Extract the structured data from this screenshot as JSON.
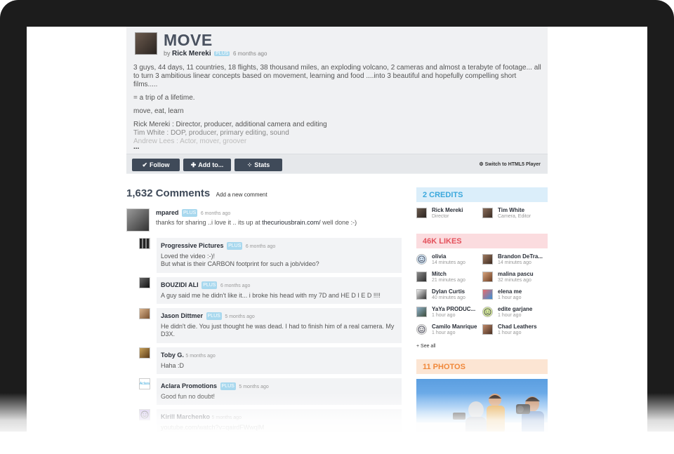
{
  "video": {
    "title": "MOVE",
    "by_prefix": "by",
    "uploader": "Rick Mereki",
    "uploader_badge": "PLUS",
    "uploaded": "6 months ago",
    "description": {
      "p1": "3 guys, 44 days, 11 countries, 18 flights, 38 thousand miles, an exploding volcano, 2 cameras and almost a terabyte of footage... all to turn 3 ambitious linear concepts based on movement, learning and food ....into 3 beautiful and hopefully compelling short films.....",
      "p2": "= a trip of a lifetime.",
      "p3": "move, eat, learn",
      "credit1": "Rick Mereki : Director, producer, additional camera and editing",
      "credit2": "Tim White : DOP, producer, primary editing, sound",
      "credit3": "Andrew Lees : Actor, mover, groover",
      "more": "..."
    }
  },
  "actions": {
    "follow": "Follow",
    "add_to": "Add to...",
    "stats": "Stats",
    "html5": "Switch to HTML5 Player"
  },
  "comments": {
    "count": "1,632 Comments",
    "add": "Add a new comment",
    "top": {
      "author": "mpared",
      "badge": "PLUS",
      "time": "6 months ago",
      "text_before": "thanks for sharing ..i love it .. its up at",
      "link": "thecuriousbrain.com/",
      "text_after": "well done :-)"
    },
    "replies": [
      {
        "author": "Progressive Pictures",
        "badge": "PLUS",
        "time": "6 months ago",
        "line1": "Loved the video :-)!",
        "line2": "But what is their CARBON footprint for such a job/video?"
      },
      {
        "author": "BOUZIDI ALI",
        "badge": "PLUS",
        "time": "6 months ago",
        "line1": "A guy said me he didn't like it... i broke his head with my 7D and HE D I E D !!!!"
      },
      {
        "author": "Jason Dittmer",
        "badge": "PLUS",
        "time": "5 months ago",
        "line1": "He didn't die. You just thought he was dead. I had to finish him of a real camera. My D3X."
      },
      {
        "author": "Toby G.",
        "time": "5 months ago",
        "line1": "Haha :D"
      },
      {
        "author": "Aclara Promotions",
        "badge": "PLUS",
        "time": "5 months ago",
        "line1": "Good fun no doubt!",
        "avatar_text": "Aclara"
      },
      {
        "author": "Kirill Marchenko",
        "time": "5 months ago",
        "line1": "youtube.com/watch?v=qairdFWwqlM"
      }
    ]
  },
  "sidebar": {
    "credits_title": "2 CREDITS",
    "credits": [
      {
        "name": "Rick Mereki",
        "role": "Director"
      },
      {
        "name": "Tim White",
        "role": "Camera, Editor"
      }
    ],
    "likes_title": "46K LIKES",
    "likes": [
      {
        "name": "olivia",
        "time": "14 minutes ago"
      },
      {
        "name": "Brandon DeTra...",
        "time": "14 minutes ago"
      },
      {
        "name": "Mitch",
        "time": "21 minutes ago"
      },
      {
        "name": "malina pascu",
        "time": "32 minutes ago"
      },
      {
        "name": "Dylan Curtis",
        "time": "40 minutes ago"
      },
      {
        "name": "elena me",
        "time": "1 hour ago"
      },
      {
        "name": "YaYa PRODUC...",
        "time": "1 hour ago"
      },
      {
        "name": "edite garjane",
        "time": "1 hour ago"
      },
      {
        "name": "Camilo Manrique",
        "time": "1 hour ago"
      },
      {
        "name": "Chad Leathers",
        "time": "1 hour ago"
      }
    ],
    "see_all": "+ See all",
    "photos_title": "11 PHOTOS"
  },
  "colors": {
    "button": "#3f4a59",
    "credits_accent": "#3ba8dc",
    "likes_accent": "#e4525c",
    "photos_accent": "#f0883a",
    "plus_badge": "#a8d8ee"
  }
}
